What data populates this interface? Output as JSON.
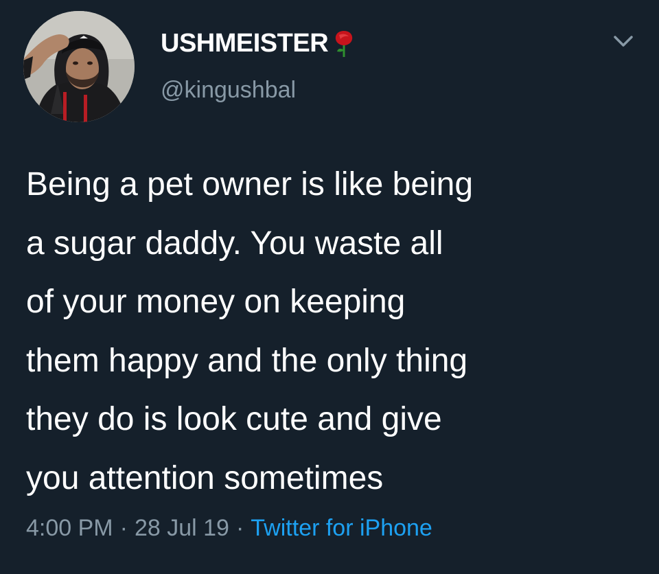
{
  "tweet": {
    "author": {
      "display_name": "USHMEISTER",
      "handle": "@kingushbal",
      "avatar_icon": "profile-photo",
      "name_emoji": "rose-icon"
    },
    "text_lines": [
      "Being a pet owner is like being",
      "a sugar daddy. You waste all",
      "of your money on keeping",
      "them happy and the only thing",
      "they do is look cute and give",
      "you attention sometimes"
    ],
    "time": "4:00 PM",
    "date": "28 Jul 19",
    "separator": "·",
    "source": "Twitter for iPhone",
    "menu_icon": "chevron-down-icon"
  },
  "colors": {
    "background": "#15202b",
    "text_primary": "#ffffff",
    "text_secondary": "#8899a6",
    "link": "#1da1f2"
  }
}
